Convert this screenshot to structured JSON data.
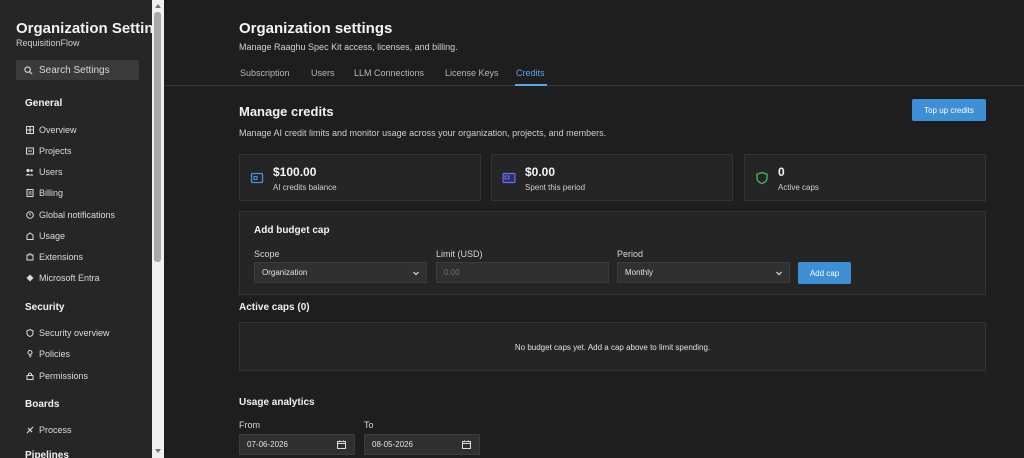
{
  "sidebar": {
    "title": "Organization Settin...",
    "subtitle": "RequisitionFlow",
    "search_placeholder": "Search Settings",
    "sections": {
      "general": "General",
      "security": "Security",
      "boards": "Boards",
      "pipelines": "Pipelines"
    },
    "items": {
      "overview": "Overview",
      "projects": "Projects",
      "users": "Users",
      "billing": "Billing",
      "global_notifications": "Global notifications",
      "usage": "Usage",
      "extensions": "Extensions",
      "microsoft_entra": "Microsoft Entra",
      "security_overview": "Security overview",
      "policies": "Policies",
      "permissions": "Permissions",
      "process": "Process"
    }
  },
  "header": {
    "title": "Organization settings",
    "subtitle": "Manage Raaghu Spec Kit access, licenses, and billing.",
    "tabs": [
      "Subscription",
      "Users",
      "LLM Connections",
      "License Keys",
      "Credits"
    ],
    "active_tab": "Credits"
  },
  "credits": {
    "title": "Manage credits",
    "description": "Manage AI credit limits and monitor usage across your organization, projects, and members.",
    "top_up_label": "Top up credits",
    "cards": [
      {
        "value": "$100.00",
        "label": "AI credits balance",
        "icon": "wallet-icon",
        "color": "#4a8fe0"
      },
      {
        "value": "$0.00",
        "label": "Spent this period",
        "icon": "card-icon",
        "color": "#6b6ef0"
      },
      {
        "value": "0",
        "label": "Active caps",
        "icon": "shield-icon",
        "color": "#3fb35a"
      }
    ]
  },
  "budget_cap": {
    "title": "Add budget cap",
    "scope_label": "Scope",
    "scope_value": "Organization",
    "limit_label": "Limit (USD)",
    "limit_placeholder": "0.00",
    "period_label": "Period",
    "period_value": "Monthly",
    "add_label": "Add cap"
  },
  "active_caps": {
    "title": "Active caps (0)",
    "empty_text": "No budget caps yet. Add a cap above to limit spending."
  },
  "analytics": {
    "title": "Usage analytics",
    "from_label": "From",
    "from_value": "07-06-2026",
    "to_label": "To",
    "to_value": "08-05-2026"
  },
  "colors": {
    "accent": "#55a8ee",
    "primary_button": "#3d8fd6"
  }
}
